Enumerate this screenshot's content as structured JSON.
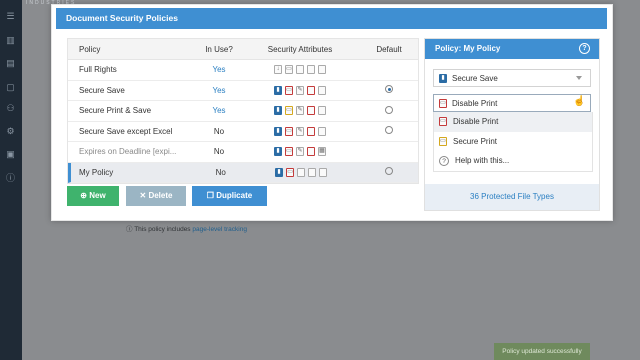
{
  "app": {
    "brand": "INDUSTRIES"
  },
  "background": {
    "policy_note_prefix": "This policy includes",
    "policy_note_link": "page-level tracking",
    "toast": "Policy updated successfully"
  },
  "dialog": {
    "title": "Document Security Policies",
    "table": {
      "headers": {
        "policy": "Policy",
        "in_use": "In Use?",
        "attributes": "Security Attributes",
        "default": "Default"
      },
      "rows": [
        {
          "policy": "Full Rights",
          "in_use": "Yes",
          "default_selected": false
        },
        {
          "policy": "Secure Save",
          "in_use": "Yes",
          "default_selected": true
        },
        {
          "policy": "Secure Print & Save",
          "in_use": "Yes",
          "default_selected": false
        },
        {
          "policy": "Secure Save except Excel",
          "in_use": "No",
          "default_selected": false
        },
        {
          "policy": "Expires on Deadline [expi...",
          "in_use": "No",
          "default_selected": false
        },
        {
          "policy": "My Policy",
          "in_use": "No",
          "default_selected": false
        }
      ]
    },
    "buttons": {
      "new": "New",
      "delete": "Delete",
      "duplicate": "Duplicate"
    },
    "panel": {
      "title": "Policy: My Policy",
      "help": "?",
      "select1": "Secure Save",
      "select2": "Disable Print",
      "options": [
        "Disable Print",
        "Secure Print",
        "Help with this..."
      ],
      "footer": "36 Protected File Types"
    }
  },
  "colors": {
    "accent": "#3f8fd2",
    "new_button": "#3fb36d",
    "delete_button": "#9bb5c4",
    "sidebar": "#1f2a36"
  }
}
